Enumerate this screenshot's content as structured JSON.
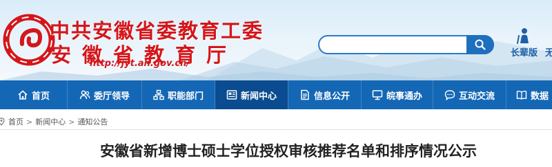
{
  "header": {
    "org_name": "中共安徽省委教育工委",
    "dept_name": "安徽省教育厅",
    "url": "http://jyt.ah.gov.cn/",
    "search": {
      "value": "",
      "placeholder": ""
    },
    "elder_mode_label": "长辈版",
    "extra_label": "无"
  },
  "nav": {
    "items": [
      {
        "label": "首页",
        "icon": "home-icon"
      },
      {
        "label": "委厅领导",
        "icon": "people-icon"
      },
      {
        "label": "职能部门",
        "icon": "org-chart-icon"
      },
      {
        "label": "新闻中心",
        "icon": "news-icon",
        "active": true
      },
      {
        "label": "信息公开",
        "icon": "document-icon"
      },
      {
        "label": "皖事通办",
        "icon": "monitor-icon"
      },
      {
        "label": "互动交流",
        "icon": "chat-icon"
      },
      {
        "label": "数据",
        "icon": "book-icon"
      }
    ]
  },
  "breadcrumb": {
    "items": [
      "首页",
      "新闻中心",
      "通知公告"
    ],
    "separator": ">"
  },
  "article": {
    "title": "安徽省新增博士硕士学位授权审核推荐名单和排序情况公示"
  },
  "colors": {
    "brand_red": "#d4161b",
    "nav_blue": "#1467b5",
    "nav_active": "#0a4c8f"
  }
}
